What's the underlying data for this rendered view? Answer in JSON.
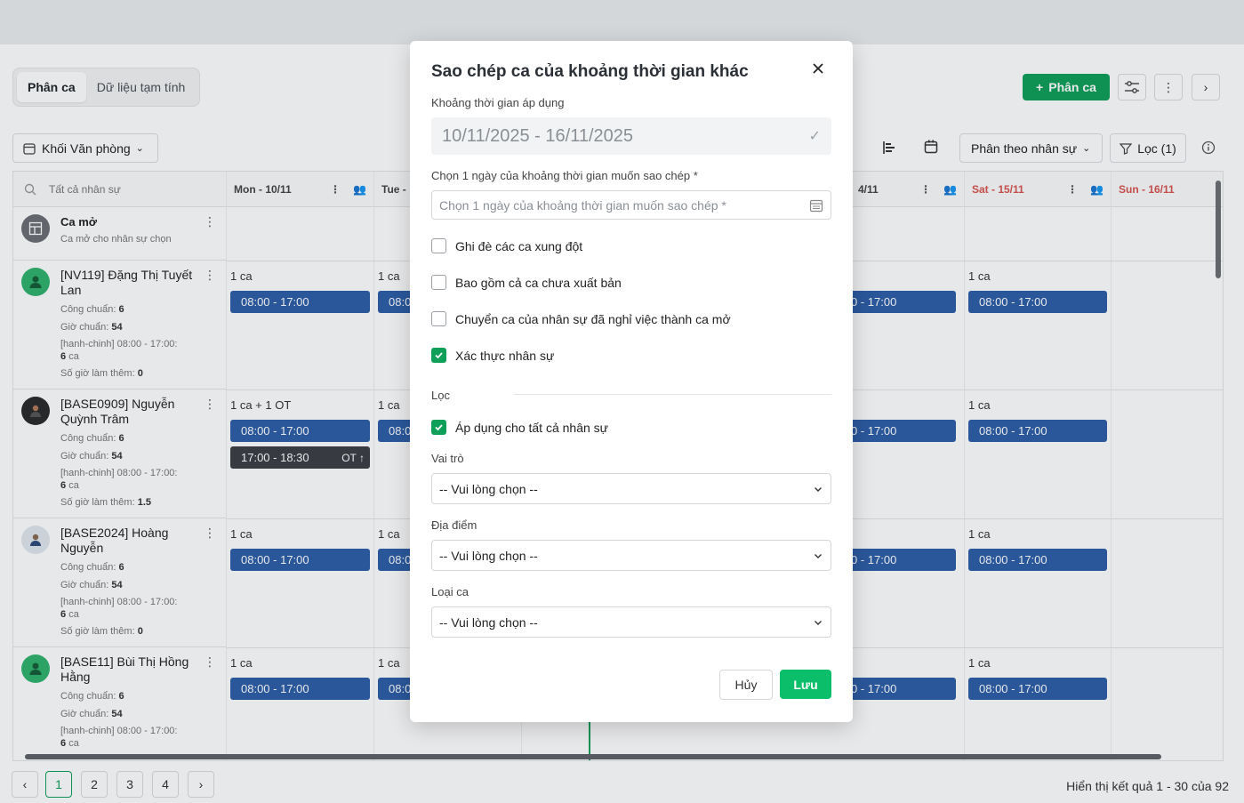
{
  "tabs": [
    "Phân ca",
    "Dữ liệu tạm tính"
  ],
  "toolbar": {
    "add_shift": "Phân ca",
    "dept": "Khối Văn phòng",
    "view_mode": "Phân theo nhân sự",
    "filter": "Lọc (1)"
  },
  "grid": {
    "search_placeholder": "Tất cả nhân sự",
    "days": [
      "Mon - 10/11",
      "Tue -",
      "4/11",
      "Sat - 15/11",
      "Sun - 16/11"
    ],
    "open_shift": {
      "title": "Ca mở",
      "subtitle": "Ca mở cho nhân sự chọn"
    },
    "employees": [
      {
        "name": "[NV119] Đặng Thị Tuyết Lan",
        "cong_label": "Công chuẩn:",
        "cong": "6",
        "gio_label": "Giờ chuẩn:",
        "gio": "54",
        "shift_info": "[hanh-chinh] 08:00 - 17:00:",
        "shift_count": "6",
        "ca_word": "ca",
        "ot_label": "Số giờ làm thêm:",
        "ot": "0",
        "mon_count": "1 ca",
        "tue_count": "1 ca",
        "sat_count": "1 ca"
      },
      {
        "name": "[BASE0909] Nguyễn Quỳnh Trâm",
        "cong_label": "Công chuẩn:",
        "cong": "6",
        "gio_label": "Giờ chuẩn:",
        "gio": "54",
        "shift_info": "[hanh-chinh] 08:00 - 17:00:",
        "shift_count": "6",
        "ca_word": "ca",
        "ot_label": "Số giờ làm thêm:",
        "ot": "1.5",
        "mon_count": "1 ca + 1 OT",
        "tue_count": "1 ca",
        "sat_count": "1 ca"
      },
      {
        "name": "[BASE2024] Hoàng Nguyễn",
        "cong_label": "Công chuẩn:",
        "cong": "6",
        "gio_label": "Giờ chuẩn:",
        "gio": "54",
        "shift_info": "[hanh-chinh] 08:00 - 17:00:",
        "shift_count": "6",
        "ca_word": "ca",
        "ot_label": "Số giờ làm thêm:",
        "ot": "0",
        "mon_count": "1 ca",
        "tue_count": "1 ca",
        "sat_count": "1 ca"
      },
      {
        "name": "[BASE11] Bùi Thị Hồng Hằng",
        "cong_label": "Công chuẩn:",
        "cong": "6",
        "gio_label": "Giờ chuẩn:",
        "gio": "54",
        "shift_info": "[hanh-chinh] 08:00 - 17:00:",
        "shift_count": "6",
        "ca_word": "ca",
        "mon_count": "1 ca",
        "tue_count": "1 ca",
        "sat_count": "1 ca"
      }
    ],
    "shift_time": "08:00 - 17:00",
    "shift_time_partial": "08:0",
    "shift_time_right": "0 - 17:00",
    "ot_shift_time": "17:00 - 18:30",
    "ot_tag": "OT"
  },
  "pagination": {
    "pages": [
      "1",
      "2",
      "3",
      "4"
    ],
    "results": "Hiển thị kết quả 1 - 30 của 92"
  },
  "modal": {
    "title": "Sao chép ca của khoảng thời gian khác",
    "range_label": "Khoảng thời gian áp dụng",
    "range_value": "10/11/2025 - 16/11/2025",
    "pick_label": "Chọn 1 ngày của khoảng thời gian muốn sao chép *",
    "pick_placeholder": "Chọn 1 ngày của khoảng thời gian muốn sao chép *",
    "options": [
      {
        "label": "Ghi đè các ca xung đột",
        "checked": false
      },
      {
        "label": "Bao gồm cả ca chưa xuất bản",
        "checked": false
      },
      {
        "label": "Chuyển ca của nhân sự đã nghỉ việc thành ca mở",
        "checked": false
      },
      {
        "label": "Xác thực nhân sự",
        "checked": true
      }
    ],
    "filter_section": "Lọc",
    "apply_all": {
      "label": "Áp dụng cho tất cả nhân sự",
      "checked": true
    },
    "role_label": "Vai trò",
    "location_label": "Địa điểm",
    "shift_type_label": "Loại ca",
    "select_placeholder": "-- Vui lòng chọn --",
    "cancel": "Hủy",
    "save": "Lưu"
  },
  "colors": {
    "primary": "#0e9f58",
    "save": "#0bbf6a",
    "shift": "#2d5ea8",
    "weekend": "#d9534f"
  }
}
